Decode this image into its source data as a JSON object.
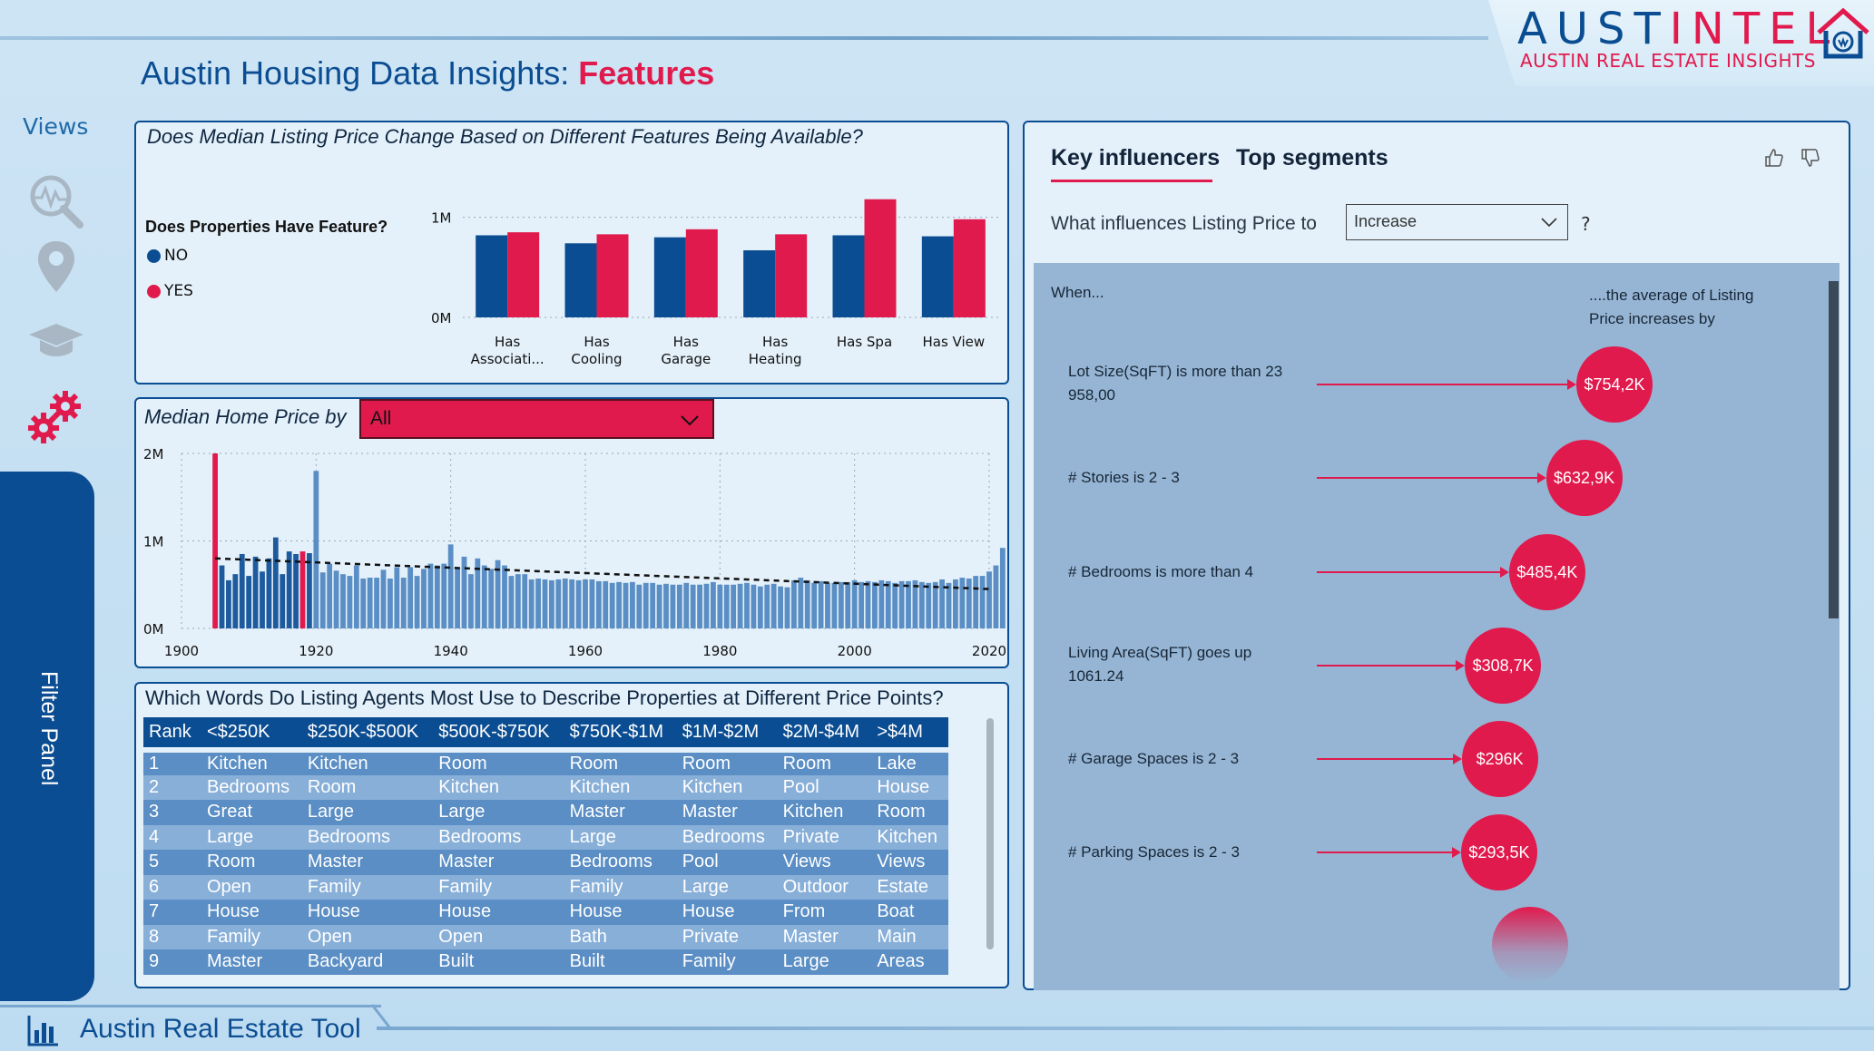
{
  "header": {
    "title_prefix": "Austin Housing Data Insights: ",
    "title_highlight": "Features",
    "logo_word_blue": "AUST",
    "logo_word_red": "INTEL",
    "logo_subtitle": "AUSTIN REAL ESTATE INSIGHTS"
  },
  "nav": {
    "views_label": "Views",
    "items": [
      {
        "icon": "analytics-search-icon"
      },
      {
        "icon": "map-pin-icon"
      },
      {
        "icon": "graduation-cap-icon"
      },
      {
        "icon": "gears-icon",
        "active": true
      }
    ],
    "filter_panel_label": "Filter Panel"
  },
  "footer": {
    "label": "Austin Real Estate Tool"
  },
  "features_panel": {
    "title": "Does Median Listing Price Change Based on Different Features Being Available?",
    "legend_title": "Does Properties Have Feature?",
    "legend": [
      {
        "label": "NO",
        "color": "#0b4d92"
      },
      {
        "label": "YES",
        "color": "#e11a4d"
      }
    ]
  },
  "year_panel": {
    "title": "Median Home Price by",
    "dropdown_value": "All"
  },
  "words_panel": {
    "title": "Which Words Do Listing Agents Most Use to Describe Properties at Different Price Points?",
    "columns": [
      "Rank",
      "<$250K",
      "$250K-$500K",
      "$500K-$750K",
      "$750K-$1M",
      "$1M-$2M",
      "$2M-$4M",
      ">$4M"
    ],
    "rows": [
      [
        "1",
        "Kitchen",
        "Kitchen",
        "Room",
        "Room",
        "Room",
        "Room",
        "Lake"
      ],
      [
        "2",
        "Bedrooms",
        "Room",
        "Kitchen",
        "Kitchen",
        "Kitchen",
        "Pool",
        "House"
      ],
      [
        "3",
        "Great",
        "Large",
        "Large",
        "Master",
        "Master",
        "Kitchen",
        "Room"
      ],
      [
        "4",
        "Large",
        "Bedrooms",
        "Bedrooms",
        "Large",
        "Bedrooms",
        "Private",
        "Kitchen"
      ],
      [
        "5",
        "Room",
        "Master",
        "Master",
        "Bedrooms",
        "Pool",
        "Views",
        "Views"
      ],
      [
        "6",
        "Open",
        "Family",
        "Family",
        "Family",
        "Large",
        "Outdoor",
        "Estate"
      ],
      [
        "7",
        "House",
        "House",
        "House",
        "House",
        "House",
        "From",
        "Boat"
      ],
      [
        "8",
        "Family",
        "Open",
        "Open",
        "Bath",
        "Private",
        "Master",
        "Main"
      ],
      [
        "9",
        "Master",
        "Backyard",
        "Built",
        "Built",
        "Family",
        "Large",
        "Areas"
      ]
    ]
  },
  "key_influencers": {
    "tab_active": "Key influencers",
    "tab_other": "Top segments",
    "question": "What influences Listing Price to",
    "select_value": "Increase",
    "question_mark": "?",
    "when_label": "When...",
    "avg_label": "....the average of Listing Price increases by",
    "influencers": [
      {
        "label": "Lot Size(SqFT) is more than 23 958,00",
        "value": "$754,2K",
        "amount": 754.2
      },
      {
        "label": "# Stories is 2 - 3",
        "value": "$632,9K",
        "amount": 632.9
      },
      {
        "label": "# Bedrooms is more than 4",
        "value": "$485,4K",
        "amount": 485.4
      },
      {
        "label": "Living Area(SqFT) goes up 1061.24",
        "value": "$308,7K",
        "amount": 308.7
      },
      {
        "label": "# Garage Spaces is 2 - 3",
        "value": "$296K",
        "amount": 296
      },
      {
        "label": "# Parking Spaces is 2 - 3",
        "value": "$293,5K",
        "amount": 293.5
      }
    ]
  },
  "chart_data": [
    {
      "type": "bar",
      "categories": [
        "Has Associati...",
        "Has Cooling",
        "Has Garage",
        "Has Heating",
        "Has Spa",
        "Has View"
      ],
      "series": [
        {
          "name": "NO",
          "values": [
            0.82,
            0.74,
            0.8,
            0.67,
            0.82,
            0.81
          ],
          "color": "#0b4d92"
        },
        {
          "name": "YES",
          "values": [
            0.85,
            0.83,
            0.88,
            0.83,
            1.18,
            0.98
          ],
          "color": "#e11a4d"
        }
      ],
      "yticks": [
        "1M",
        "0M"
      ],
      "ylim": [
        0,
        1.25
      ]
    },
    {
      "type": "bar",
      "x_start": 1902,
      "x_step": 1,
      "xticks": [
        "1900",
        "1920",
        "1940",
        "1960",
        "1980",
        "2000",
        "2020"
      ],
      "yticks": [
        "2M",
        "1M",
        "0M"
      ],
      "ylim": [
        0,
        2
      ],
      "xlim": [
        1900,
        2020
      ],
      "highlight": {
        "1905": "#e11a4d",
        "1918": "#e11a4d"
      },
      "values": [
        0,
        0,
        0,
        2.0,
        0.72,
        0.55,
        0.62,
        0.85,
        0.6,
        0.82,
        0.65,
        0.8,
        1.04,
        0.62,
        0.88,
        0.85,
        0.88,
        0.86,
        1.8,
        0.64,
        0.74,
        0.66,
        0.62,
        0.6,
        0.72,
        0.57,
        0.58,
        0.58,
        0.67,
        0.57,
        0.7,
        0.58,
        0.7,
        0.6,
        0.68,
        0.74,
        0.72,
        0.74,
        0.96,
        0.68,
        0.82,
        0.62,
        0.8,
        0.72,
        0.68,
        0.78,
        0.72,
        0.6,
        0.62,
        0.62,
        0.56,
        0.57,
        0.56,
        0.55,
        0.56,
        0.57,
        0.56,
        0.55,
        0.56,
        0.56,
        0.54,
        0.54,
        0.52,
        0.53,
        0.52,
        0.53,
        0.5,
        0.52,
        0.52,
        0.5,
        0.51,
        0.5,
        0.5,
        0.52,
        0.5,
        0.5,
        0.51,
        0.53,
        0.5,
        0.5,
        0.5,
        0.51,
        0.52,
        0.5,
        0.48,
        0.5,
        0.51,
        0.48,
        0.47,
        0.55,
        0.58,
        0.55,
        0.52,
        0.54,
        0.52,
        0.52,
        0.53,
        0.53,
        0.55,
        0.53,
        0.54,
        0.53,
        0.55,
        0.54,
        0.52,
        0.54,
        0.54,
        0.55,
        0.53,
        0.52,
        0.53,
        0.56,
        0.52,
        0.56,
        0.58,
        0.57,
        0.6,
        0.6,
        0.65,
        0.72,
        0.92
      ],
      "trend": [
        0.8,
        0.45
      ]
    }
  ]
}
